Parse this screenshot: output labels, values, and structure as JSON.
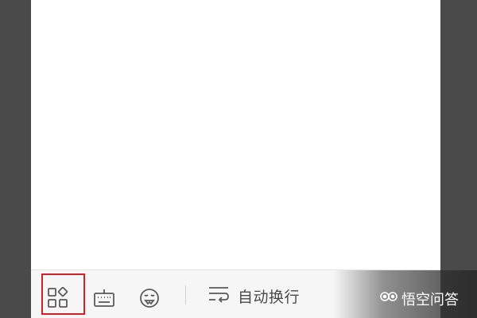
{
  "toolbar": {
    "buttons": [
      {
        "icon": "apps-grid-icon",
        "highlighted": true
      },
      {
        "icon": "keyboard-icon"
      },
      {
        "icon": "emoji-face-icon"
      }
    ],
    "word_wrap": {
      "icon": "word-wrap-icon",
      "label": "自动换行"
    }
  },
  "watermark": {
    "logo": "wukong-logo",
    "text": "悟空问答"
  },
  "colors": {
    "highlight_border": "#d0202a",
    "icon": "#5a5a5a",
    "toolbar_bg": "#f6f6f6",
    "side_bg": "#4a4a4a"
  }
}
